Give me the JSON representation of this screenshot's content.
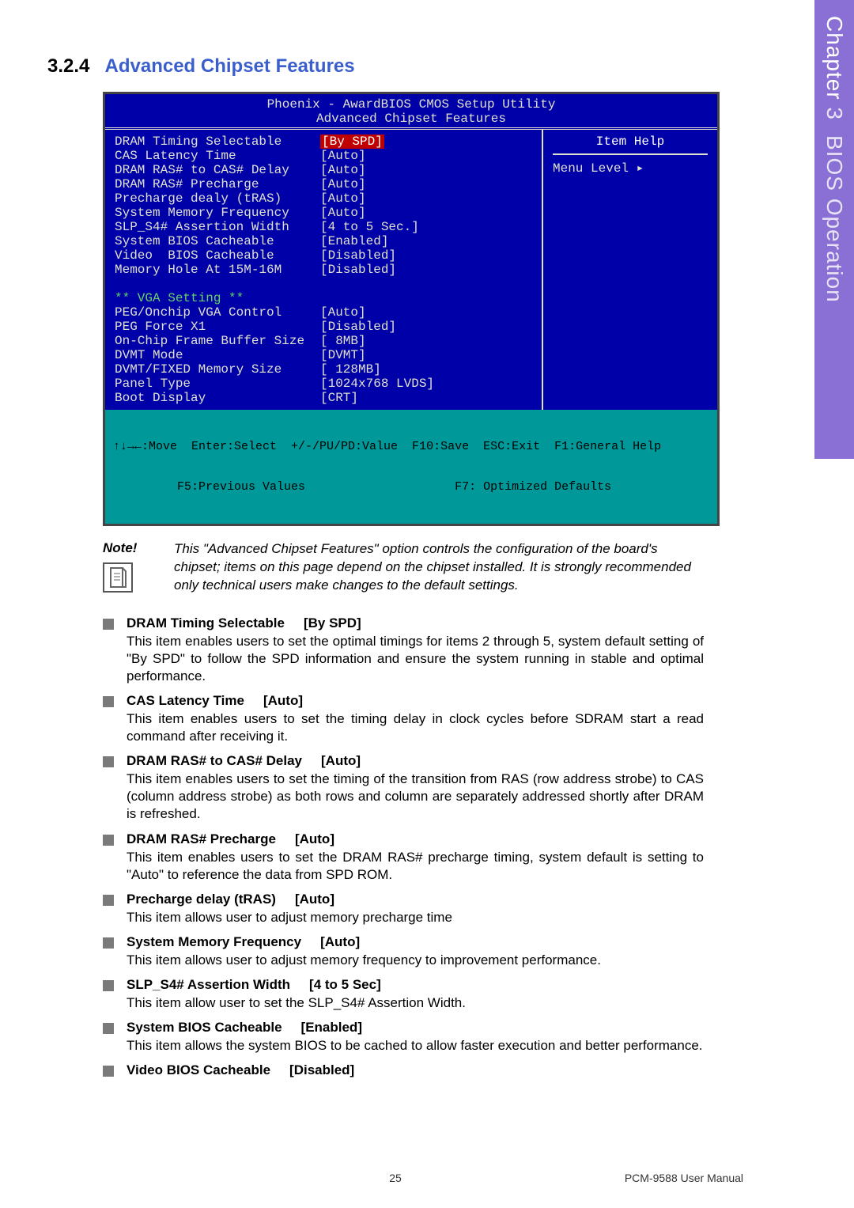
{
  "side_tab": {
    "chapter": "Chapter",
    "num": "3",
    "title": "BIOS Operation"
  },
  "section": {
    "number": "3.2.4",
    "title": "Advanced Chipset Features"
  },
  "bios": {
    "header_line1": "Phoenix - AwardBIOS CMOS Setup Utility",
    "header_line2": "Advanced Chipset Features",
    "item_help": "Item Help",
    "menu_level": "Menu Level   ▸",
    "rows": [
      {
        "label": "DRAM Timing Selectable",
        "value": "[By SPD]",
        "hilite": true
      },
      {
        "label": "CAS Latency Time",
        "value": "[Auto]"
      },
      {
        "label": "DRAM RAS# to CAS# Delay",
        "value": "[Auto]"
      },
      {
        "label": "DRAM RAS# Precharge",
        "value": "[Auto]"
      },
      {
        "label": "Precharge dealy (tRAS)",
        "value": "[Auto]"
      },
      {
        "label": "System Memory Frequency",
        "value": "[Auto]"
      },
      {
        "label": "SLP_S4# Assertion Width",
        "value": "[4 to 5 Sec.]"
      },
      {
        "label": "System BIOS Cacheable",
        "value": "[Enabled]"
      },
      {
        "label": "Video  BIOS Cacheable",
        "value": "[Disabled]"
      },
      {
        "label": "Memory Hole At 15M-16M",
        "value": "[Disabled]"
      }
    ],
    "vga_header": "** VGA Setting **",
    "vga_rows": [
      {
        "label": "PEG/Onchip VGA Control",
        "value": "[Auto]"
      },
      {
        "label": "PEG Force X1",
        "value": "[Disabled]"
      },
      {
        "label": "On-Chip Frame Buffer Size",
        "value": "[ 8MB]"
      },
      {
        "label": "DVMT Mode",
        "value": "[DVMT]"
      },
      {
        "label": "DVMT/FIXED Memory Size",
        "value": "[ 128MB]"
      },
      {
        "label": "Panel Type",
        "value": "[1024x768 LVDS]"
      },
      {
        "label": "Boot Display",
        "value": "[CRT]"
      }
    ],
    "footer_line1": "↑↓→←:Move  Enter:Select  +/-/PU/PD:Value  F10:Save  ESC:Exit  F1:General Help",
    "footer_line2": "         F5:Previous Values                     F7: Optimized Defaults"
  },
  "note": {
    "label": "Note!",
    "text": "This \"Advanced Chipset Features\" option controls the configuration of the board's chipset; items on this page depend on the chipset installed. It is strongly recommended only technical users make changes to the default settings."
  },
  "items": [
    {
      "title": "DRAM Timing Selectable",
      "opt": "[By SPD]",
      "desc": "This item enables users to set the optimal timings for items 2 through 5, system default setting of \"By SPD\" to follow the SPD information and ensure the system running in stable and optimal performance."
    },
    {
      "title": "CAS Latency Time",
      "opt": "[Auto]",
      "desc": "This item enables users to set the timing delay in clock cycles before SDRAM start a read command after receiving it."
    },
    {
      "title": "DRAM RAS# to CAS# Delay",
      "opt": "[Auto]",
      "desc": "This item enables users to set the timing of the transition from RAS (row address strobe) to CAS (column address strobe) as both rows and column are separately addressed shortly after DRAM is refreshed."
    },
    {
      "title": "DRAM RAS# Precharge",
      "opt": "[Auto]",
      "desc": "This item enables users to set the DRAM RAS# precharge timing, system default is setting to \"Auto\" to reference the data from SPD ROM."
    },
    {
      "title": "Precharge delay (tRAS)",
      "opt": "[Auto]",
      "desc": "This item allows user to adjust memory precharge time"
    },
    {
      "title": "System Memory Frequency",
      "opt": "[Auto]",
      "desc": "This item allows user to adjust memory frequency to improvement performance."
    },
    {
      "title": "SLP_S4# Assertion Width",
      "opt": "[4 to 5 Sec]",
      "desc": "This item allow user to set the SLP_S4# Assertion Width."
    },
    {
      "title": "System BIOS Cacheable",
      "opt": "[Enabled]",
      "desc": "This item allows the system BIOS to be cached to allow faster execution and better performance."
    },
    {
      "title": "Video BIOS Cacheable",
      "opt": "[Disabled]",
      "desc": ""
    }
  ],
  "footer": {
    "page": "25",
    "manual": "PCM-9588 User Manual"
  }
}
